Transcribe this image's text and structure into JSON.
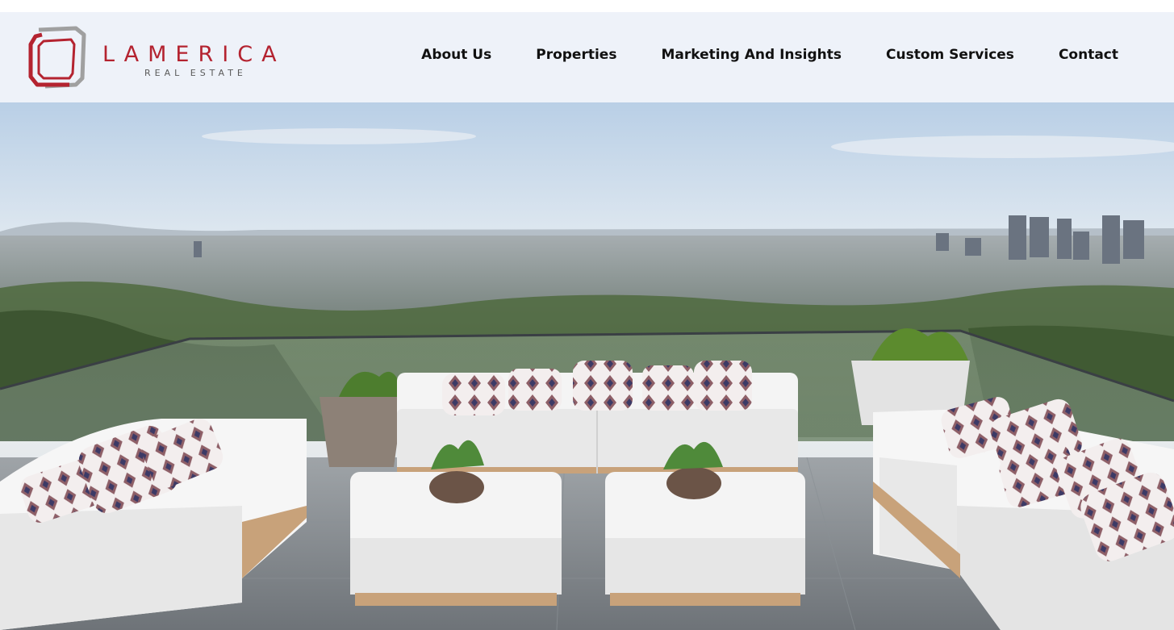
{
  "brand": {
    "name": "LAMERICA",
    "tagline": "REAL ESTATE",
    "colors": {
      "primary": "#b42330",
      "secondary": "#9a9a9a"
    }
  },
  "nav": {
    "items": [
      {
        "label": "About Us"
      },
      {
        "label": "Properties"
      },
      {
        "label": "Marketing And Insights"
      },
      {
        "label": "Custom Services"
      },
      {
        "label": "Contact"
      }
    ]
  },
  "hero": {
    "icon": "rooftop-terrace-city-view-photo"
  }
}
